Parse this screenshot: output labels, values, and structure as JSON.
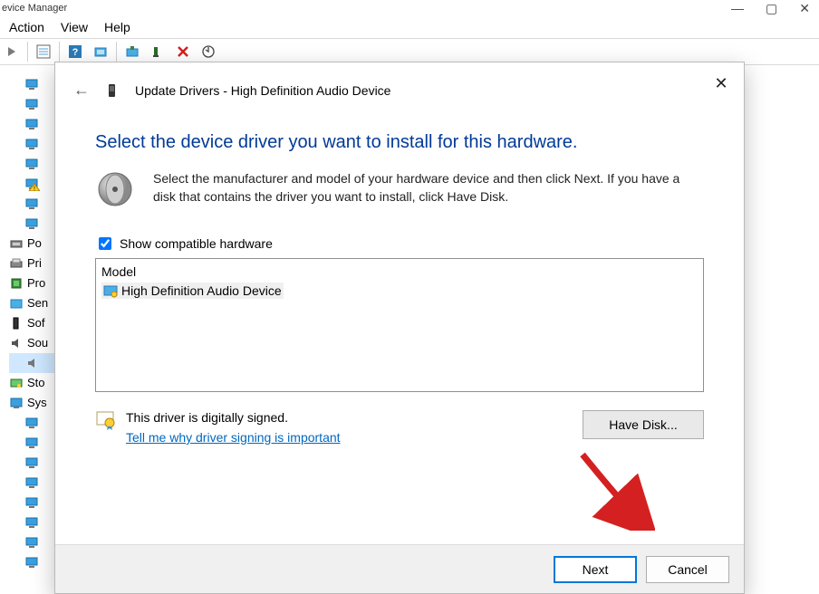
{
  "window": {
    "title_fragment": "evice Manager"
  },
  "menubar": {
    "action": "Action",
    "view": "View",
    "help": "Help"
  },
  "tree": {
    "items": [
      {
        "label": ""
      },
      {
        "label": ""
      },
      {
        "label": ""
      },
      {
        "label": ""
      },
      {
        "label": ""
      },
      {
        "label": ""
      },
      {
        "label": ""
      },
      {
        "label": ""
      },
      {
        "label": "Po"
      },
      {
        "label": "Pri"
      },
      {
        "label": "Pro"
      },
      {
        "label": "Sen"
      },
      {
        "label": "Sof"
      },
      {
        "label": "Sou"
      },
      {
        "label": ""
      },
      {
        "label": "Sto"
      },
      {
        "label": "Sys"
      },
      {
        "label": ""
      },
      {
        "label": ""
      },
      {
        "label": ""
      },
      {
        "label": ""
      },
      {
        "label": ""
      },
      {
        "label": ""
      },
      {
        "label": ""
      },
      {
        "label": ""
      }
    ]
  },
  "dialog": {
    "title": "Update Drivers - High Definition Audio Device",
    "instruction": "Select the device driver you want to install for this hardware.",
    "description": "Select the manufacturer and model of your hardware device and then click Next. If you have a disk that contains the driver you want to install, click Have Disk.",
    "show_compatible_label": "Show compatible hardware",
    "model_header": "Model",
    "model_item": "High Definition Audio Device",
    "signed_text": "This driver is digitally signed.",
    "signing_link": "Tell me why driver signing is important",
    "have_disk": "Have Disk...",
    "next": "Next",
    "cancel": "Cancel"
  }
}
